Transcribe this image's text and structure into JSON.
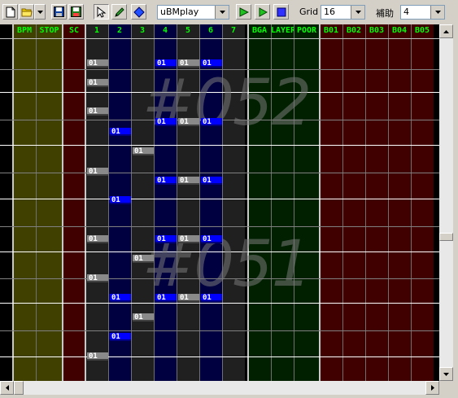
{
  "toolbar": {
    "player_value": "uBMplay",
    "grid_label": "Grid",
    "grid_value": "16",
    "assist_label": "補助",
    "assist_value": "4"
  },
  "editor": {
    "columns": [
      {
        "label": "BPM",
        "color": "#404000"
      },
      {
        "label": "STOP",
        "color": "#404000"
      },
      {
        "label": "SC",
        "color": "#400000"
      },
      {
        "label": "1",
        "color": "#202020"
      },
      {
        "label": "2",
        "color": "#000040"
      },
      {
        "label": "3",
        "color": "#202020"
      },
      {
        "label": "4",
        "color": "#000040"
      },
      {
        "label": "5",
        "color": "#202020"
      },
      {
        "label": "6",
        "color": "#000040"
      },
      {
        "label": "7",
        "color": "#202020"
      },
      {
        "label": "BGA",
        "color": "#002000"
      },
      {
        "label": "LAYER",
        "color": "#002000"
      },
      {
        "label": "POOR",
        "color": "#002000"
      },
      {
        "label": "B01",
        "color": "#400000"
      },
      {
        "label": "B02",
        "color": "#400000"
      },
      {
        "label": "B03",
        "color": "#400000"
      },
      {
        "label": "B04",
        "color": "#400000"
      },
      {
        "label": "B05",
        "color": "#400000"
      }
    ],
    "measures": [
      "#052",
      "#051"
    ],
    "note_label": "01",
    "notes": [
      {
        "col": "1",
        "color": "gray"
      },
      {
        "col": "4",
        "color": "blue"
      },
      {
        "col": "5",
        "color": "gray"
      },
      {
        "col": "6",
        "color": "blue"
      },
      {
        "col": "1",
        "color": "gray"
      },
      {
        "col": "1",
        "color": "gray"
      },
      {
        "col": "4",
        "color": "blue"
      },
      {
        "col": "5",
        "color": "gray"
      },
      {
        "col": "6",
        "color": "blue"
      },
      {
        "col": "2",
        "color": "blue"
      },
      {
        "col": "3",
        "color": "gray"
      },
      {
        "col": "1",
        "color": "gray"
      },
      {
        "col": "4",
        "color": "blue"
      },
      {
        "col": "5",
        "color": "gray"
      },
      {
        "col": "6",
        "color": "blue"
      },
      {
        "col": "2",
        "color": "blue"
      },
      {
        "col": "1",
        "color": "gray"
      },
      {
        "col": "4",
        "color": "blue"
      },
      {
        "col": "5",
        "color": "gray"
      },
      {
        "col": "6",
        "color": "blue"
      },
      {
        "col": "3",
        "color": "gray"
      },
      {
        "col": "1",
        "color": "gray"
      },
      {
        "col": "2",
        "color": "blue"
      },
      {
        "col": "4",
        "color": "blue"
      },
      {
        "col": "5",
        "color": "gray"
      },
      {
        "col": "6",
        "color": "blue"
      },
      {
        "col": "3",
        "color": "gray"
      },
      {
        "col": "2",
        "color": "blue"
      },
      {
        "col": "1",
        "color": "gray"
      }
    ]
  }
}
